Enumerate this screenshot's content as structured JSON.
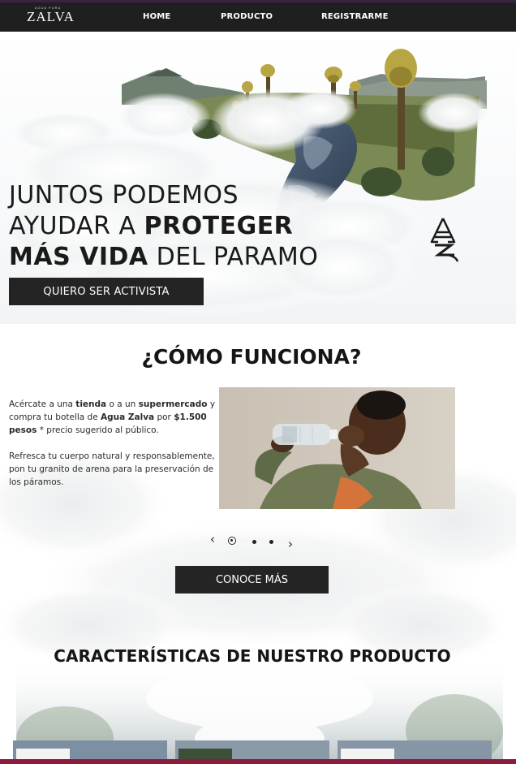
{
  "nav": {
    "brand_sup": "AGUA PURA",
    "brand": "ZALVA",
    "links": [
      "HOME",
      "PRODUCTO",
      "REGISTRARME"
    ]
  },
  "hero": {
    "line1": "JUNTOS PODEMOS",
    "line2_a": "AYUDAR A ",
    "line2_b": "PROTEGER",
    "line3_a": "MÁS VIDA",
    "line3_b": " DEL PARAMO",
    "cta": "QUIERO SER ACTIVISTA"
  },
  "how": {
    "title_a": "¿CÓMO ",
    "title_b": "FUNCIONA?",
    "p1": {
      "t1": "Acércate a una ",
      "b1": "tienda",
      "t2": " o a un ",
      "b2": "supermercado",
      "t3": " y compra tu botella de ",
      "b3": "Agua Zalva",
      "t4": " por ",
      "b4": "$1.500 pesos",
      "t5": " * precio sugerido al público."
    },
    "p2": "Refresca tu cuerpo natural y responsablemente, pon tu granito de arena para la preservación de los páramos.",
    "carousel": {
      "prev": "‹",
      "next": "›",
      "slides": 3,
      "active": 1
    },
    "cta": "CONOCE MÁS"
  },
  "features": {
    "title_a": "CARACTERÍSTICAS DE NUESTRO ",
    "title_b": "PRODUCTO"
  },
  "colors": {
    "nav_bg": "#1f1f20",
    "button_bg": "#242424",
    "accent_bottom": "#8b1d3b"
  }
}
